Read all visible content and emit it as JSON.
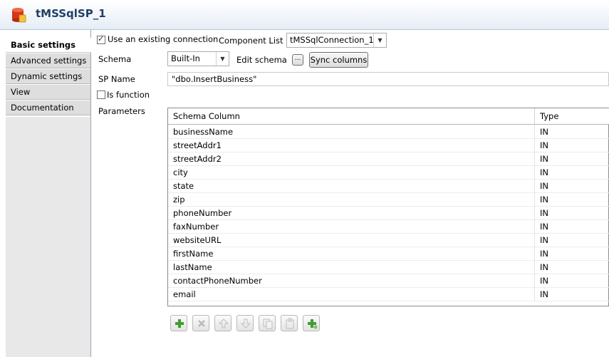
{
  "header": {
    "title": "tMSSqlSP_1",
    "icon": "database-component-icon"
  },
  "sidebar": {
    "items": [
      {
        "label": "Basic settings",
        "active": true
      },
      {
        "label": "Advanced settings"
      },
      {
        "label": "Dynamic settings"
      },
      {
        "label": "View"
      },
      {
        "label": "Documentation"
      }
    ]
  },
  "connection": {
    "use_existing_label": "Use an existing connection",
    "use_existing_checked": true,
    "component_list_label": "Component List",
    "component_list_value": "tMSSqlConnection_1"
  },
  "schema": {
    "label": "Schema",
    "value": "Built-In",
    "edit_label": "Edit schema",
    "edit_button": "...",
    "sync_label": "Sync columns"
  },
  "sp": {
    "name_label": "SP Name",
    "name_value": "\"dbo.InsertBusiness\"",
    "is_function_label": "Is function",
    "is_function_checked": false
  },
  "parameters": {
    "label": "Parameters",
    "columns": [
      "Schema Column",
      "Type"
    ],
    "rows": [
      [
        "businessName",
        "IN"
      ],
      [
        "streetAddr1",
        "IN"
      ],
      [
        "streetAddr2",
        "IN"
      ],
      [
        "city",
        "IN"
      ],
      [
        "state",
        "IN"
      ],
      [
        "zip",
        "IN"
      ],
      [
        "phoneNumber",
        "IN"
      ],
      [
        "faxNumber",
        "IN"
      ],
      [
        "websiteURL",
        "IN"
      ],
      [
        "firstName",
        "IN"
      ],
      [
        "lastName",
        "IN"
      ],
      [
        "contactPhoneNumber",
        "IN"
      ],
      [
        "email",
        "IN"
      ]
    ]
  },
  "toolbar": {
    "buttons": [
      "add-icon",
      "remove-icon",
      "move-up-icon",
      "move-down-icon",
      "copy-icon",
      "paste-icon",
      "add-all-icon"
    ]
  },
  "colors": {
    "accent_green": "#3f9e2f",
    "title_blue": "#1f3f66"
  }
}
